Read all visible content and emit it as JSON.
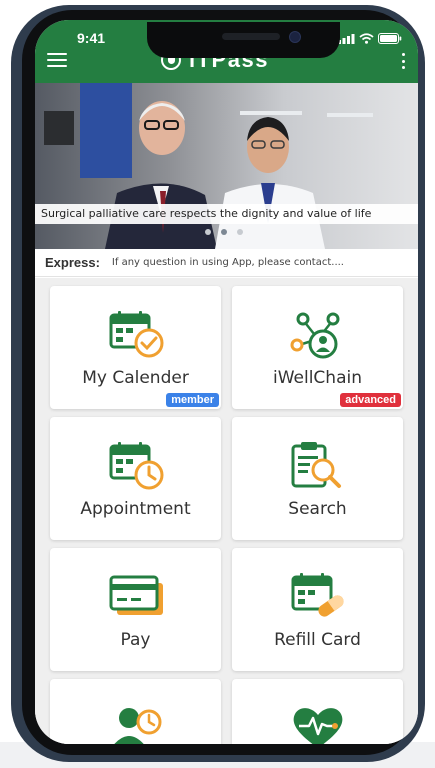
{
  "status_bar": {
    "time": "9:41"
  },
  "header": {
    "title": "iTPass"
  },
  "banner": {
    "caption": "Surgical palliative care respects the dignity and value of life",
    "slide_count": 3,
    "active_slide": 2
  },
  "express": {
    "label": "Express:",
    "message": "If any question in using App, please contact...."
  },
  "tiles": [
    {
      "label": "My Calender",
      "icon": "calendar-check-icon",
      "badge": "member",
      "badge_color": "#3b82e8"
    },
    {
      "label": "iWellChain",
      "icon": "network-person-icon",
      "badge": "advanced",
      "badge_color": "#e0303c"
    },
    {
      "label": "Appointment",
      "icon": "calendar-clock-icon"
    },
    {
      "label": "Search",
      "icon": "clipboard-search-icon"
    },
    {
      "label": "Pay",
      "icon": "credit-card-icon"
    },
    {
      "label": "Refill Card",
      "icon": "calendar-pill-icon"
    },
    {
      "label": "",
      "icon": "person-clock-icon"
    },
    {
      "label": "",
      "icon": "heart-pulse-icon"
    }
  ],
  "colors": {
    "brand_green": "#247e41",
    "accent_orange": "#f0a030",
    "icon_green": "#247e41"
  }
}
